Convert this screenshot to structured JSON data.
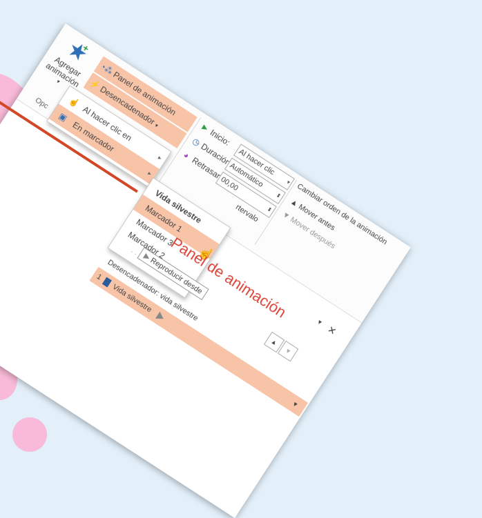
{
  "ribbon": {
    "add_animation_label_line1": "Agregar",
    "add_animation_label_line2": "animación",
    "animation_panel_label": "Panel de animación",
    "trigger_label": "Desencadenador",
    "group_label": "Opc"
  },
  "trigger_menu": {
    "items": [
      {
        "label": "Al hacer clic en"
      },
      {
        "label": "En marcador"
      }
    ]
  },
  "bookmark_menu": {
    "items": [
      {
        "label": "Vida silvestre"
      },
      {
        "label": "Marcador 1"
      },
      {
        "label": "Marcador 3"
      },
      {
        "label": "Marcador 2"
      }
    ],
    "more": "· · · ·"
  },
  "timing": {
    "start_label": "Inicio:",
    "start_value": "Al hacer clic",
    "duration_label": "Duración:",
    "duration_value": "Automático",
    "delay_label": "Retrasar:",
    "delay_value": "00,00",
    "interval_fragment": "rtervalo",
    "reorder_title": "Cambiar orden de la animación",
    "move_earlier": "Mover antes",
    "move_later": "Mover después"
  },
  "animation_pane": {
    "title": "Panel de animación",
    "play_from": "Reproducir desde",
    "trigger_header": "Desencadenador: vida silvestre",
    "item_number": "1",
    "item_label": "Vida silvestre",
    "close_glyph": "✕",
    "pin_glyph": "▾"
  }
}
